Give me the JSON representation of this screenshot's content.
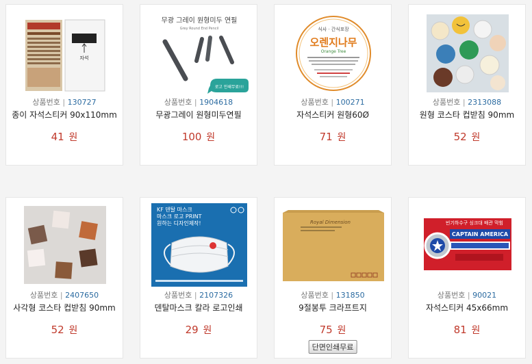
{
  "products": [
    {
      "code_label": "상품번호",
      "code": "130727",
      "name": "종이 자석스티커 90x110mm",
      "price": "41",
      "unit": "원"
    },
    {
      "code_label": "상품번호",
      "code": "1904618",
      "name": "무광그레이 원형미두연필",
      "price": "100",
      "unit": "원"
    },
    {
      "code_label": "상품번호",
      "code": "100271",
      "name": "자석스티커 원형60Ø",
      "price": "71",
      "unit": "원"
    },
    {
      "code_label": "상품번호",
      "code": "2313088",
      "name": "원형 코스타 컵받침 90mm",
      "price": "52",
      "unit": "원"
    },
    {
      "code_label": "상품번호",
      "code": "2407650",
      "name": "사각형 코스타 컵받침 90mm",
      "price": "52",
      "unit": "원"
    },
    {
      "code_label": "상품번호",
      "code": "2107326",
      "name": "덴탈마스크 칼라 로고인쇄",
      "price": "29",
      "unit": "원"
    },
    {
      "code_label": "상품번호",
      "code": "131850",
      "name": "9절봉투 크라프트지",
      "price": "75",
      "unit": "원",
      "badge": "단면인쇄무료"
    },
    {
      "code_label": "상품번호",
      "code": "90021",
      "name": "자석스티커 45x66mm",
      "price": "81",
      "unit": "원"
    }
  ],
  "images": {
    "magnet_label": "자석",
    "pencil_title": "무광 그레이 원형미두 연필",
    "pencil_subtitle": "Grey Round End Pencil",
    "pencil_badge": "로고 인쇄무료!!!",
    "orange_top": "식사 · 간식포장",
    "orange_name": "오렌지나무",
    "orange_en": "Orange Tree",
    "mask_line1": "KF 덴탈 마스크",
    "mask_line2": "마스크 로고 PRINT",
    "mask_line3": "원하는 디자인제작!",
    "envelope_brand": "Royal Dimension",
    "captain_top": "빈기하수구 싱크대 배관 막힘",
    "captain_word": "CAPTAIN AMERICA"
  },
  "colors": {
    "price": "#c0392b",
    "code_number": "#2a6aa0"
  }
}
